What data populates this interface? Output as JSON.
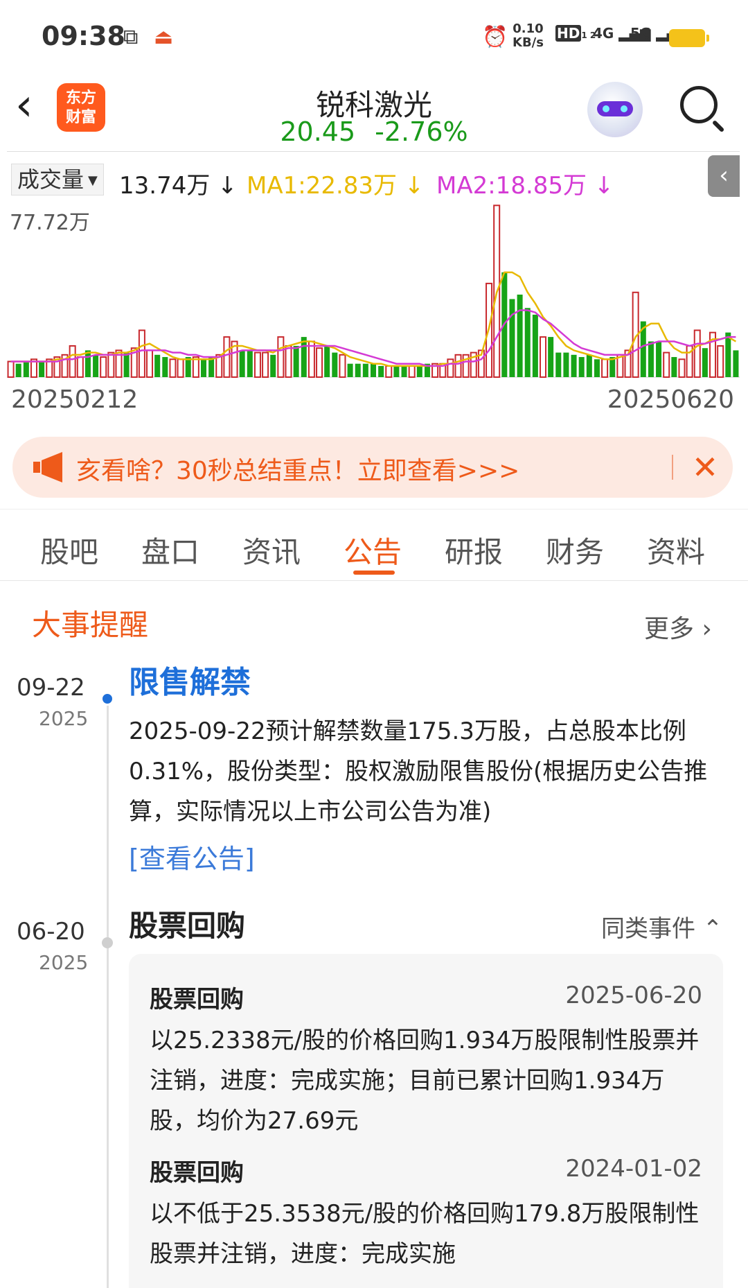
{
  "status_bar": {
    "time": "09:38",
    "net_speed_value": "0.10",
    "net_speed_unit": "KB/s",
    "hd_label": "HD",
    "hd_sub": "1 2",
    "sig_4g": "4G",
    "sig_5g": "5G",
    "battery_color": "#f4c21a"
  },
  "header": {
    "logo_line1": "东方",
    "logo_line2": "财富",
    "stock_name": "锐科激光",
    "price": "20.45",
    "change": "-2.76%",
    "price_color": "#1a9a1a"
  },
  "volume": {
    "selector_label": "成交量",
    "value": "13.74万 ↓",
    "ma1": "MA1:22.83万 ↓",
    "ma2": "MA2:18.85万 ↓",
    "y_max_label": "77.72万",
    "x_start": "20250212",
    "x_end": "20250620"
  },
  "chart_data": {
    "type": "bar",
    "title": "",
    "xlabel": "",
    "ylabel": "",
    "ylim": [
      0,
      77.72
    ],
    "x_range": [
      "20250212",
      "20250620"
    ],
    "series": [
      {
        "name": "成交量",
        "values": [
          7,
          6,
          7,
          8,
          7,
          8,
          9,
          10,
          14,
          9,
          12,
          10,
          9,
          11,
          12,
          11,
          13,
          21,
          12,
          10,
          9,
          8,
          8,
          9,
          9,
          8,
          9,
          10,
          18,
          16,
          12,
          12,
          11,
          11,
          10,
          18,
          14,
          14,
          18,
          16,
          13,
          14,
          11,
          10,
          6,
          6,
          6,
          6,
          5,
          5,
          5,
          5,
          5,
          5,
          6,
          6,
          6,
          8,
          10,
          10,
          11,
          12,
          42,
          77,
          47,
          35,
          37,
          31,
          28,
          18,
          18,
          11,
          11,
          10,
          9,
          10,
          8,
          8,
          9,
          10,
          12,
          38,
          25,
          16,
          16,
          11,
          9,
          8,
          14,
          21,
          13,
          20,
          14,
          20,
          12
        ],
        "directions": [
          "r",
          "g",
          "g",
          "r",
          "g",
          "r",
          "r",
          "r",
          "r",
          "r",
          "g",
          "g",
          "r",
          "r",
          "r",
          "g",
          "r",
          "r",
          "r",
          "g",
          "g",
          "r",
          "r",
          "g",
          "r",
          "g",
          "g",
          "r",
          "r",
          "r",
          "g",
          "g",
          "r",
          "r",
          "g",
          "r",
          "r",
          "g",
          "g",
          "r",
          "r",
          "g",
          "g",
          "r",
          "g",
          "g",
          "g",
          "g",
          "g",
          "r",
          "g",
          "g",
          "r",
          "g",
          "g",
          "r",
          "r",
          "r",
          "r",
          "r",
          "r",
          "r",
          "r",
          "r",
          "g",
          "g",
          "g",
          "g",
          "g",
          "r",
          "g",
          "g",
          "g",
          "g",
          "g",
          "g",
          "g",
          "r",
          "g",
          "r",
          "r",
          "r",
          "g",
          "g",
          "g",
          "r",
          "g",
          "r",
          "r",
          "r",
          "g",
          "r",
          "r",
          "g",
          "g"
        ]
      },
      {
        "name": "MA1",
        "color": "#e8b900",
        "values": [
          7,
          7,
          7,
          7,
          7,
          7,
          8,
          8,
          10,
          10,
          11,
          11,
          10,
          10,
          11,
          11,
          12,
          14,
          15,
          13,
          11,
          9,
          8,
          8,
          8,
          8,
          8,
          9,
          12,
          14,
          14,
          13,
          12,
          12,
          11,
          13,
          14,
          15,
          16,
          16,
          15,
          14,
          13,
          11,
          9,
          8,
          7,
          6,
          6,
          5,
          5,
          5,
          5,
          5,
          5,
          5,
          6,
          6,
          7,
          8,
          9,
          10,
          22,
          38,
          47,
          47,
          45,
          38,
          33,
          27,
          23,
          18,
          14,
          12,
          11,
          10,
          9,
          8,
          8,
          9,
          10,
          18,
          22,
          24,
          24,
          17,
          13,
          11,
          11,
          14,
          15,
          17,
          17,
          18,
          16
        ]
      },
      {
        "name": "MA2",
        "color": "#d43ad4",
        "values": [
          7,
          7,
          7,
          7,
          7,
          7,
          7,
          8,
          8,
          9,
          9,
          10,
          10,
          10,
          10,
          10,
          11,
          12,
          12,
          12,
          12,
          11,
          11,
          10,
          10,
          9,
          9,
          9,
          10,
          11,
          12,
          12,
          12,
          12,
          12,
          12,
          13,
          13,
          14,
          14,
          14,
          14,
          14,
          13,
          12,
          11,
          10,
          9,
          8,
          7,
          6,
          6,
          6,
          6,
          5,
          5,
          5,
          6,
          6,
          7,
          7,
          8,
          12,
          18,
          24,
          28,
          30,
          30,
          29,
          26,
          24,
          21,
          18,
          15,
          13,
          12,
          11,
          10,
          10,
          10,
          10,
          12,
          14,
          15,
          16,
          16,
          16,
          15,
          14,
          15,
          15,
          16,
          17,
          18,
          18
        ]
      }
    ]
  },
  "promo": {
    "text": "亥看啥？30秒总结重点！立即查看>>>",
    "close_symbol": "✕"
  },
  "tabs": [
    "股吧",
    "盘口",
    "资讯",
    "公告",
    "研报",
    "财务",
    "资料"
  ],
  "active_tab": "公告",
  "events": {
    "section_title": "大事提醒",
    "more_label": "更多 ›",
    "event1": {
      "date_md": "09-22",
      "date_y": "2025",
      "title": "限售解禁",
      "body": "2025-09-22预计解禁数量175.3万股，占总股本比例0.31%，股份类型：股权激励限售股份(根据历史公告推算，实际情况以上市公司公告为准)",
      "link": "[查看公告]"
    },
    "event2": {
      "date_md": "06-20",
      "date_y": "2025",
      "title": "股票回购",
      "same_type_label": "同类事件 ⌃",
      "items": [
        {
          "title": "股票回购",
          "date": "2025-06-20",
          "body": "以25.2338元/股的价格回购1.934万股限制性股票并注销，进度：完成实施；目前已累计回购1.934万股，均价为27.69元"
        },
        {
          "title": "股票回购",
          "date": "2024-01-02",
          "body": "以不低于25.3538元/股的价格回购179.8万股限制性股票并注销，进度：完成实施"
        }
      ]
    }
  }
}
